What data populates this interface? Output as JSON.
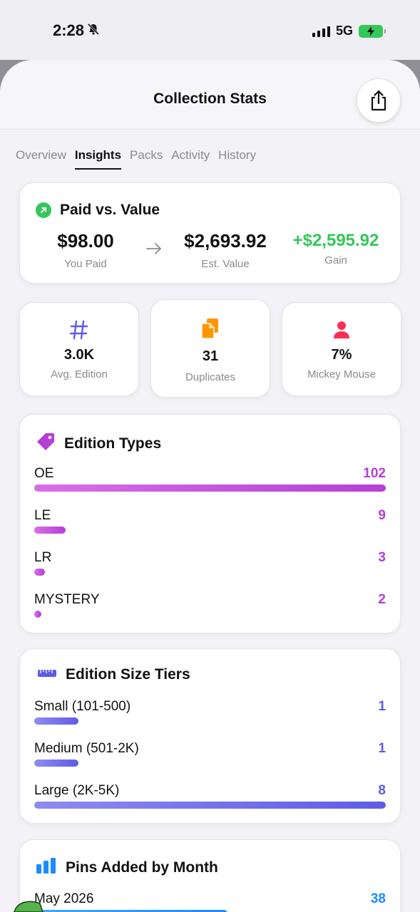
{
  "status_bar": {
    "time": "2:28",
    "network": "5G"
  },
  "header": {
    "title": "Collection Stats"
  },
  "tabs": [
    {
      "label": "Overview",
      "active": false
    },
    {
      "label": "Insights",
      "active": true
    },
    {
      "label": "Packs",
      "active": false
    },
    {
      "label": "Activity",
      "active": false
    },
    {
      "label": "History",
      "active": false
    }
  ],
  "paid_vs_value": {
    "title": "Paid vs. Value",
    "paid": {
      "value": "$98.00",
      "label": "You Paid"
    },
    "estimate": {
      "value": "$2,693.92",
      "label": "Est. Value"
    },
    "gain": {
      "value": "+$2,595.92",
      "label": "Gain"
    }
  },
  "stats": [
    {
      "icon": "hashtag-icon",
      "value": "3.0K",
      "label": "Avg. Edition"
    },
    {
      "icon": "documents-icon",
      "value": "31",
      "label": "Duplicates"
    },
    {
      "icon": "person-icon",
      "value": "7%",
      "label": "Mickey Mouse"
    }
  ],
  "edition_types": {
    "title": "Edition Types",
    "max": 102,
    "items": [
      {
        "name": "OE",
        "count": "102",
        "value": 102
      },
      {
        "name": "LE",
        "count": "9",
        "value": 9
      },
      {
        "name": "LR",
        "count": "3",
        "value": 3
      },
      {
        "name": "MYSTERY",
        "count": "2",
        "value": 2
      }
    ]
  },
  "size_tiers": {
    "title": "Edition Size Tiers",
    "max": 8,
    "items": [
      {
        "name": "Small (101-500)",
        "count": "1",
        "value": 1
      },
      {
        "name": "Medium (501-2K)",
        "count": "1",
        "value": 1
      },
      {
        "name": "Large (2K-5K)",
        "count": "8",
        "value": 8
      }
    ]
  },
  "pins_by_month": {
    "title": "Pins Added by Month",
    "items": [
      {
        "name": "May 2026",
        "count": "38",
        "fraction": 0.55
      }
    ]
  },
  "colors": {
    "accent_purple": "#b43fd6",
    "tier_indigo": "#5e5ce6",
    "gain_green": "#34c759",
    "month_blue": "#1a8cff",
    "stat_orange": "#ff9500",
    "stat_red": "#ff2d55"
  }
}
